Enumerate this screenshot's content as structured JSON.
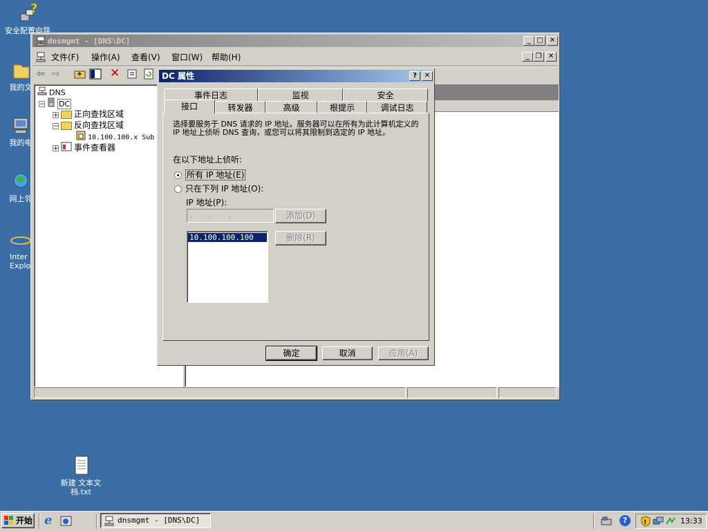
{
  "desktop": {
    "icons": [
      {
        "label": "安全配置向导",
        "icon": "security-wizard-icon"
      },
      {
        "label": "我的文",
        "icon": "my-documents-icon"
      },
      {
        "label": "我的电",
        "icon": "my-computer-icon"
      },
      {
        "label": "网上邻",
        "icon": "network-icon"
      },
      {
        "label": "Inter\nExplo",
        "icon": "internet-explorer-icon"
      },
      {
        "label": "新建 文本文\n档.txt",
        "icon": "text-file-icon"
      }
    ]
  },
  "mmc": {
    "title": "dnsmgmt - [DNS\\DC]",
    "menu": [
      "文件(F)",
      "操作(A)",
      "查看(V)",
      "窗口(W)",
      "帮助(H)"
    ],
    "tree": {
      "root": "DNS",
      "server": "DC",
      "forward": "正向查找区域",
      "reverse": "反向查找区域",
      "subnet": "10.100.100.x Sub",
      "events": "事件查看器"
    }
  },
  "dialog": {
    "title": "DC 属性",
    "tabs_back": [
      "事件日志",
      "监视",
      "安全"
    ],
    "tabs_front": [
      "接口",
      "转发器",
      "高级",
      "根提示",
      "调试日志"
    ],
    "selected_tab": "接口",
    "description": "选择要服务于 DNS 请求的 IP 地址。服务器可以在所有为此计算机定义的 IP 地址上侦听 DNS 查询，或您可以将其限制到选定的 IP 地址。",
    "listen_label": "在以下地址上侦听:",
    "radio_all": "所有 IP 地址(E)",
    "radio_only": "只在下列 IP 地址(O):",
    "ip_label": "IP 地址(P):",
    "ip_placeholder": " .       .       .",
    "add_button": "添加(D)",
    "remove_button": "删除(R)",
    "ip_list": [
      "10.100.100.100"
    ],
    "ok_button": "确定",
    "cancel_button": "取消",
    "apply_button": "应用(A)"
  },
  "taskbar": {
    "start": "开始",
    "task": "dnsmgmt - [DNS\\DC]",
    "clock": "13:33"
  },
  "colors": {
    "desktop": "#3a6ea5",
    "titlebar_active": "#0a246a",
    "selection": "#0a246a"
  }
}
